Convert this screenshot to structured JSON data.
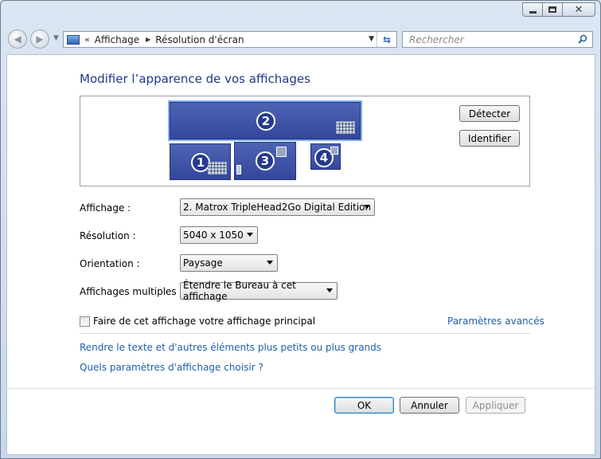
{
  "window": {
    "caption": {
      "minimize": "minimize",
      "maximize": "maximize",
      "close": "close"
    }
  },
  "nav": {
    "breadcrumb_chevron": "«",
    "crumbs": [
      "Affichage",
      "Résolution d'écran"
    ],
    "search_placeholder": "Rechercher"
  },
  "page": {
    "title": "Modifier l’apparence de vos affichages"
  },
  "preview": {
    "monitors": [
      {
        "number": "2",
        "selected": true
      },
      {
        "number": "1",
        "selected": false
      },
      {
        "number": "3",
        "selected": false
      },
      {
        "number": "4",
        "selected": false
      }
    ],
    "detect_label": "Détecter",
    "identify_label": "Identifier"
  },
  "settings": {
    "display_label": "Affichage :",
    "display_value": "2. Matrox TripleHead2Go Digital Edition",
    "resolution_label": "Résolution :",
    "resolution_value": "5040 x 1050",
    "orientation_label": "Orientation :",
    "orientation_value": "Paysage",
    "multiple_label": "Affichages multiples :",
    "multiple_value": "Étendre le Bureau à cet affichage"
  },
  "options": {
    "primary_checkbox_label": "Faire de cet affichage votre affichage principal",
    "primary_checked": false,
    "advanced_link": "Paramètres avancés",
    "text_size_link": "Rendre le texte et d'autres éléments plus petits ou plus grands",
    "which_settings_link": "Quels paramètres d'affichage choisir ?"
  },
  "footer": {
    "ok_label": "OK",
    "cancel_label": "Annuler",
    "apply_label": "Appliquer"
  }
}
